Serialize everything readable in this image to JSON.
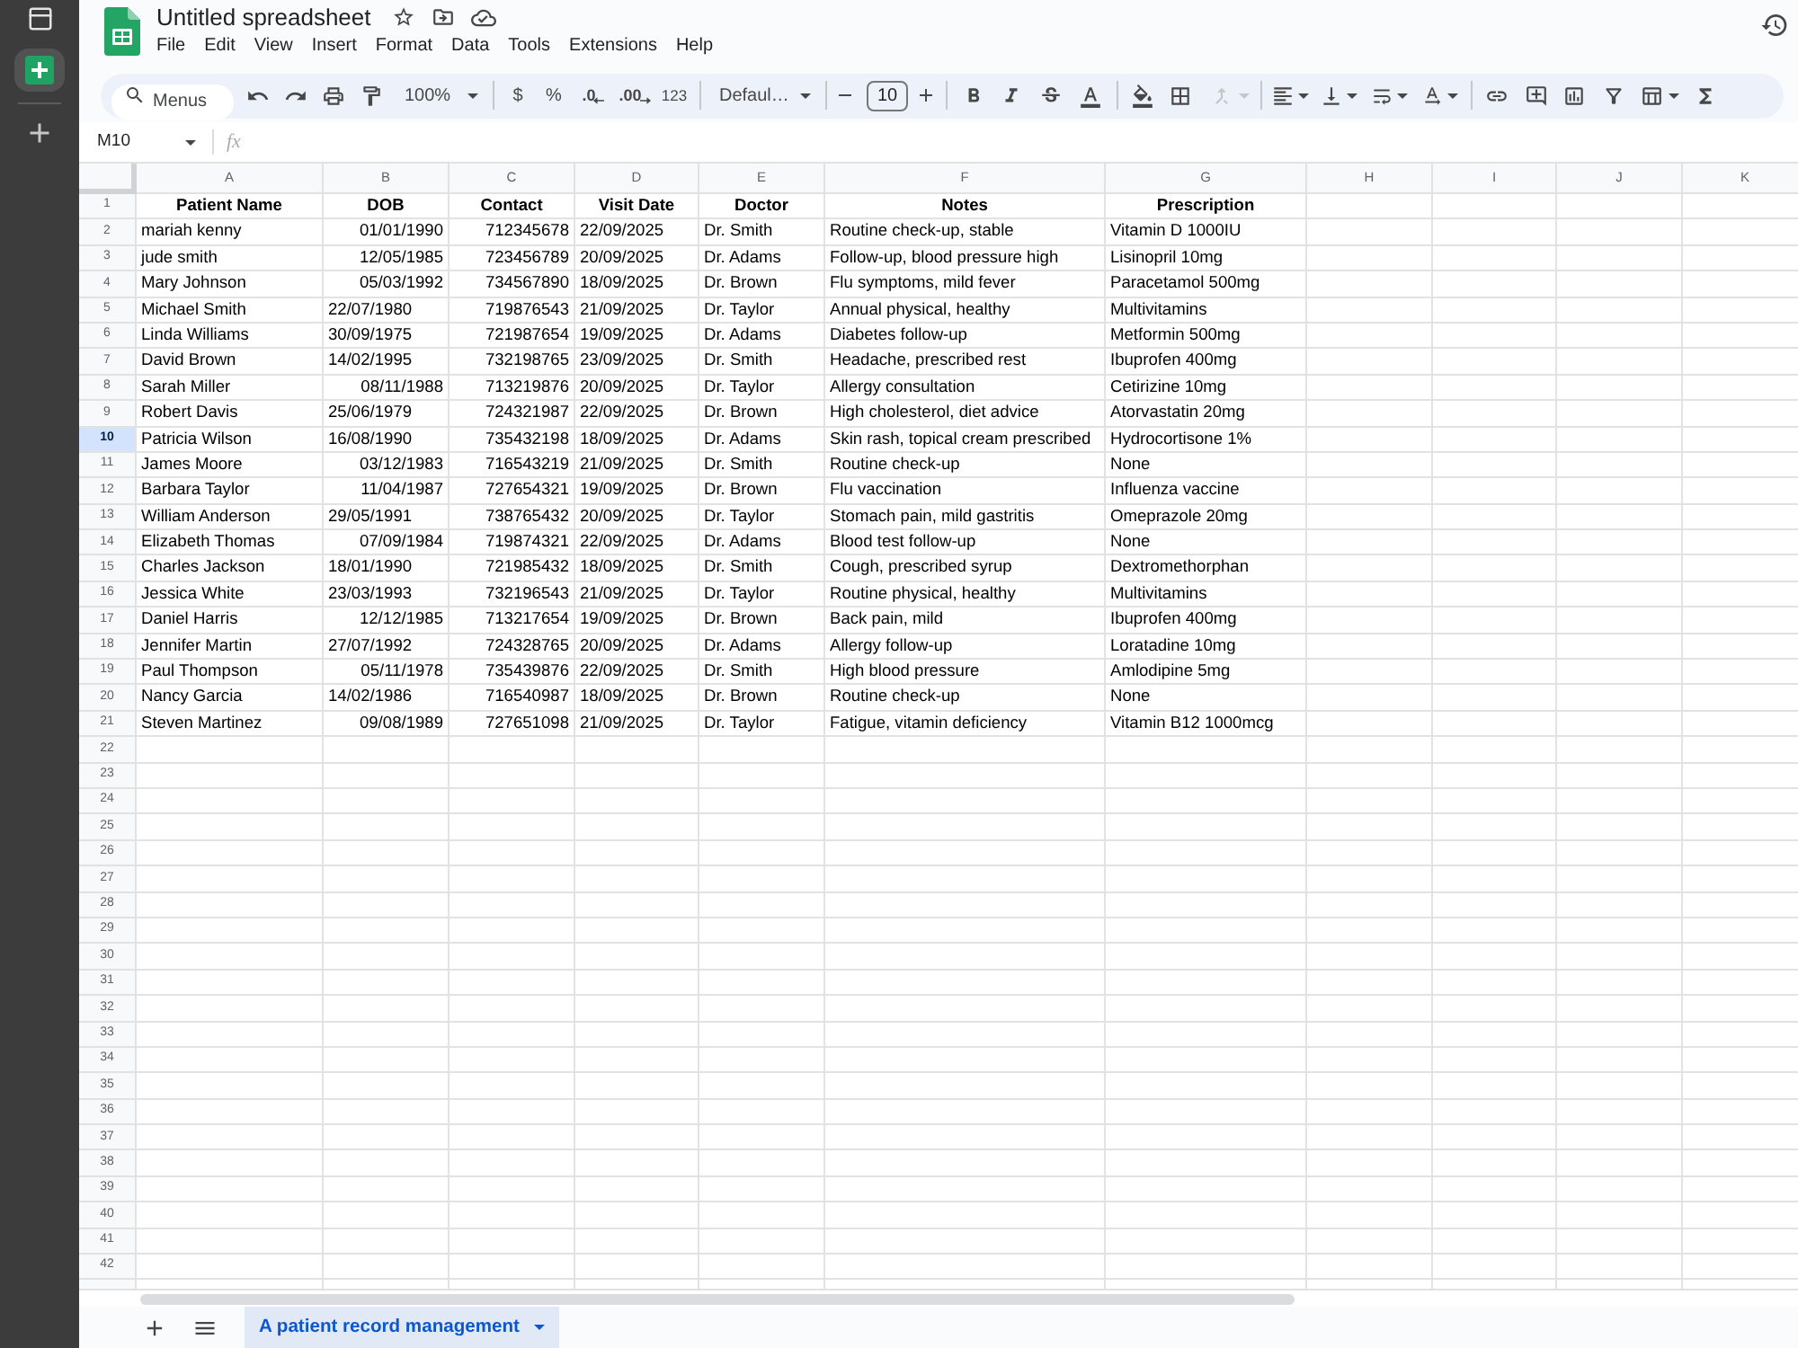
{
  "rail": {
    "items": [
      {
        "kind": "panel",
        "selected": false
      },
      {
        "kind": "sheets",
        "selected": true
      },
      {
        "kind": "add",
        "selected": false
      }
    ]
  },
  "app": {
    "title": "Untitled spreadsheet",
    "menu": [
      "File",
      "Edit",
      "View",
      "Insert",
      "Format",
      "Data",
      "Tools",
      "Extensions",
      "Help"
    ]
  },
  "toolbar": {
    "search": {
      "placeholder": "Menus"
    },
    "zoom": "100%",
    "currency": "$",
    "percent": "%",
    "decrease_decimal": ".0",
    "increase_decimal": ".00",
    "number_formats": "123",
    "font": "Defaul…",
    "font_size": {
      "value": "10"
    },
    "merge": {
      "disabled": true
    }
  },
  "formula_bar": {
    "cell": "M10",
    "function_label": "fx"
  },
  "grid": {
    "columns": [
      "A",
      "B",
      "C",
      "D",
      "E",
      "F",
      "G",
      "H",
      "I",
      "J",
      "K"
    ],
    "rows": [
      {
        "number": "1",
        "selected": false,
        "cells": [
          {
            "text": "Patient Name",
            "kind": "heading"
          },
          {
            "text": "DOB",
            "kind": "heading"
          },
          {
            "text": "Contact",
            "kind": "heading"
          },
          {
            "text": "Visit Date",
            "kind": "heading"
          },
          {
            "text": "Doctor",
            "kind": "heading"
          },
          {
            "text": "Notes",
            "kind": "heading"
          },
          {
            "text": "Prescription",
            "kind": "heading"
          }
        ]
      },
      {
        "number": "2",
        "selected": false,
        "cells": [
          {
            "text": "mariah kenny",
            "kind": "text"
          },
          {
            "text": "01/01/1990",
            "kind": "number"
          },
          {
            "text": "712345678",
            "kind": "number"
          },
          {
            "text": "22/09/2025",
            "kind": "text"
          },
          {
            "text": "Dr. Smith",
            "kind": "text"
          },
          {
            "text": "Routine check-up, stable",
            "kind": "text"
          },
          {
            "text": "Vitamin D 1000IU",
            "kind": "text"
          }
        ]
      },
      {
        "number": "3",
        "selected": false,
        "cells": [
          {
            "text": "jude smith",
            "kind": "text"
          },
          {
            "text": "12/05/1985",
            "kind": "number"
          },
          {
            "text": "723456789",
            "kind": "number"
          },
          {
            "text": "20/09/2025",
            "kind": "text"
          },
          {
            "text": "Dr. Adams",
            "kind": "text"
          },
          {
            "text": "Follow-up, blood pressure high",
            "kind": "text"
          },
          {
            "text": "Lisinopril 10mg",
            "kind": "text"
          }
        ]
      },
      {
        "number": "4",
        "selected": false,
        "cells": [
          {
            "text": "Mary Johnson",
            "kind": "text"
          },
          {
            "text": "05/03/1992",
            "kind": "number"
          },
          {
            "text": "734567890",
            "kind": "number"
          },
          {
            "text": "18/09/2025",
            "kind": "text"
          },
          {
            "text": "Dr. Brown",
            "kind": "text"
          },
          {
            "text": "Flu symptoms, mild fever",
            "kind": "text"
          },
          {
            "text": "Paracetamol 500mg",
            "kind": "text"
          }
        ]
      },
      {
        "number": "5",
        "selected": false,
        "cells": [
          {
            "text": "Michael Smith",
            "kind": "text"
          },
          {
            "text": "22/07/1980",
            "kind": "text"
          },
          {
            "text": "719876543",
            "kind": "number"
          },
          {
            "text": "21/09/2025",
            "kind": "text"
          },
          {
            "text": "Dr. Taylor",
            "kind": "text"
          },
          {
            "text": "Annual physical, healthy",
            "kind": "text"
          },
          {
            "text": "Multivitamins",
            "kind": "text"
          }
        ]
      },
      {
        "number": "6",
        "selected": false,
        "cells": [
          {
            "text": "Linda Williams",
            "kind": "text"
          },
          {
            "text": "30/09/1975",
            "kind": "text"
          },
          {
            "text": "721987654",
            "kind": "number"
          },
          {
            "text": "19/09/2025",
            "kind": "text"
          },
          {
            "text": "Dr. Adams",
            "kind": "text"
          },
          {
            "text": "Diabetes follow-up",
            "kind": "text"
          },
          {
            "text": "Metformin 500mg",
            "kind": "text"
          }
        ]
      },
      {
        "number": "7",
        "selected": false,
        "cells": [
          {
            "text": "David Brown",
            "kind": "text"
          },
          {
            "text": "14/02/1995",
            "kind": "text"
          },
          {
            "text": "732198765",
            "kind": "number"
          },
          {
            "text": "23/09/2025",
            "kind": "text"
          },
          {
            "text": "Dr. Smith",
            "kind": "text"
          },
          {
            "text": "Headache, prescribed rest",
            "kind": "text"
          },
          {
            "text": "Ibuprofen 400mg",
            "kind": "text"
          }
        ]
      },
      {
        "number": "8",
        "selected": false,
        "cells": [
          {
            "text": "Sarah Miller",
            "kind": "text"
          },
          {
            "text": "08/11/1988",
            "kind": "number"
          },
          {
            "text": "713219876",
            "kind": "number"
          },
          {
            "text": "20/09/2025",
            "kind": "text"
          },
          {
            "text": "Dr. Taylor",
            "kind": "text"
          },
          {
            "text": "Allergy consultation",
            "kind": "text"
          },
          {
            "text": "Cetirizine 10mg",
            "kind": "text"
          }
        ]
      },
      {
        "number": "9",
        "selected": false,
        "cells": [
          {
            "text": "Robert Davis",
            "kind": "text"
          },
          {
            "text": "25/06/1979",
            "kind": "text"
          },
          {
            "text": "724321987",
            "kind": "number"
          },
          {
            "text": "22/09/2025",
            "kind": "text"
          },
          {
            "text": "Dr. Brown",
            "kind": "text"
          },
          {
            "text": "High cholesterol, diet advice",
            "kind": "text"
          },
          {
            "text": "Atorvastatin 20mg",
            "kind": "text"
          }
        ]
      },
      {
        "number": "10",
        "selected": true,
        "cells": [
          {
            "text": "Patricia Wilson",
            "kind": "text"
          },
          {
            "text": "16/08/1990",
            "kind": "text"
          },
          {
            "text": "735432198",
            "kind": "number"
          },
          {
            "text": "18/09/2025",
            "kind": "text"
          },
          {
            "text": "Dr. Adams",
            "kind": "text"
          },
          {
            "text": "Skin rash, topical cream prescribed",
            "kind": "text"
          },
          {
            "text": "Hydrocortisone 1%",
            "kind": "text"
          }
        ]
      },
      {
        "number": "11",
        "selected": false,
        "cells": [
          {
            "text": "James Moore",
            "kind": "text"
          },
          {
            "text": "03/12/1983",
            "kind": "number"
          },
          {
            "text": "716543219",
            "kind": "number"
          },
          {
            "text": "21/09/2025",
            "kind": "text"
          },
          {
            "text": "Dr. Smith",
            "kind": "text"
          },
          {
            "text": "Routine check-up",
            "kind": "text"
          },
          {
            "text": "None",
            "kind": "text"
          }
        ]
      },
      {
        "number": "12",
        "selected": false,
        "cells": [
          {
            "text": "Barbara Taylor",
            "kind": "text"
          },
          {
            "text": "11/04/1987",
            "kind": "number"
          },
          {
            "text": "727654321",
            "kind": "number"
          },
          {
            "text": "19/09/2025",
            "kind": "text"
          },
          {
            "text": "Dr. Brown",
            "kind": "text"
          },
          {
            "text": "Flu vaccination",
            "kind": "text"
          },
          {
            "text": "Influenza vaccine",
            "kind": "text"
          }
        ]
      },
      {
        "number": "13",
        "selected": false,
        "cells": [
          {
            "text": "William Anderson",
            "kind": "text"
          },
          {
            "text": "29/05/1991",
            "kind": "text"
          },
          {
            "text": "738765432",
            "kind": "number"
          },
          {
            "text": "20/09/2025",
            "kind": "text"
          },
          {
            "text": "Dr. Taylor",
            "kind": "text"
          },
          {
            "text": "Stomach pain, mild gastritis",
            "kind": "text"
          },
          {
            "text": "Omeprazole 20mg",
            "kind": "text"
          }
        ]
      },
      {
        "number": "14",
        "selected": false,
        "cells": [
          {
            "text": "Elizabeth Thomas",
            "kind": "text"
          },
          {
            "text": "07/09/1984",
            "kind": "number"
          },
          {
            "text": "719874321",
            "kind": "number"
          },
          {
            "text": "22/09/2025",
            "kind": "text"
          },
          {
            "text": "Dr. Adams",
            "kind": "text"
          },
          {
            "text": "Blood test follow-up",
            "kind": "text"
          },
          {
            "text": "None",
            "kind": "text"
          }
        ]
      },
      {
        "number": "15",
        "selected": false,
        "cells": [
          {
            "text": "Charles Jackson",
            "kind": "text"
          },
          {
            "text": "18/01/1990",
            "kind": "text"
          },
          {
            "text": "721985432",
            "kind": "number"
          },
          {
            "text": "18/09/2025",
            "kind": "text"
          },
          {
            "text": "Dr. Smith",
            "kind": "text"
          },
          {
            "text": "Cough, prescribed syrup",
            "kind": "text"
          },
          {
            "text": "Dextromethorphan",
            "kind": "text"
          }
        ]
      },
      {
        "number": "16",
        "selected": false,
        "cells": [
          {
            "text": "Jessica White",
            "kind": "text"
          },
          {
            "text": "23/03/1993",
            "kind": "text"
          },
          {
            "text": "732196543",
            "kind": "number"
          },
          {
            "text": "21/09/2025",
            "kind": "text"
          },
          {
            "text": "Dr. Taylor",
            "kind": "text"
          },
          {
            "text": "Routine physical, healthy",
            "kind": "text"
          },
          {
            "text": "Multivitamins",
            "kind": "text"
          }
        ]
      },
      {
        "number": "17",
        "selected": false,
        "cells": [
          {
            "text": "Daniel Harris",
            "kind": "text"
          },
          {
            "text": "12/12/1985",
            "kind": "number"
          },
          {
            "text": "713217654",
            "kind": "number"
          },
          {
            "text": "19/09/2025",
            "kind": "text"
          },
          {
            "text": "Dr. Brown",
            "kind": "text"
          },
          {
            "text": "Back pain, mild",
            "kind": "text"
          },
          {
            "text": "Ibuprofen 400mg",
            "kind": "text"
          }
        ]
      },
      {
        "number": "18",
        "selected": false,
        "cells": [
          {
            "text": "Jennifer Martin",
            "kind": "text"
          },
          {
            "text": "27/07/1992",
            "kind": "text"
          },
          {
            "text": "724328765",
            "kind": "number"
          },
          {
            "text": "20/09/2025",
            "kind": "text"
          },
          {
            "text": "Dr. Adams",
            "kind": "text"
          },
          {
            "text": "Allergy follow-up",
            "kind": "text"
          },
          {
            "text": "Loratadine 10mg",
            "kind": "text"
          }
        ]
      },
      {
        "number": "19",
        "selected": false,
        "cells": [
          {
            "text": "Paul Thompson",
            "kind": "text"
          },
          {
            "text": "05/11/1978",
            "kind": "number"
          },
          {
            "text": "735439876",
            "kind": "number"
          },
          {
            "text": "22/09/2025",
            "kind": "text"
          },
          {
            "text": "Dr. Smith",
            "kind": "text"
          },
          {
            "text": "High blood pressure",
            "kind": "text"
          },
          {
            "text": "Amlodipine 5mg",
            "kind": "text"
          }
        ]
      },
      {
        "number": "20",
        "selected": false,
        "cells": [
          {
            "text": "Nancy Garcia",
            "kind": "text"
          },
          {
            "text": "14/02/1986",
            "kind": "text"
          },
          {
            "text": "716540987",
            "kind": "number"
          },
          {
            "text": "18/09/2025",
            "kind": "text"
          },
          {
            "text": "Dr. Brown",
            "kind": "text"
          },
          {
            "text": "Routine check-up",
            "kind": "text"
          },
          {
            "text": "None",
            "kind": "text"
          }
        ]
      },
      {
        "number": "21",
        "selected": false,
        "cells": [
          {
            "text": "Steven Martinez",
            "kind": "text"
          },
          {
            "text": "09/08/1989",
            "kind": "number"
          },
          {
            "text": "727651098",
            "kind": "number"
          },
          {
            "text": "21/09/2025",
            "kind": "text"
          },
          {
            "text": "Dr. Taylor",
            "kind": "text"
          },
          {
            "text": "Fatigue, vitamin deficiency",
            "kind": "text"
          },
          {
            "text": "Vitamin B12 1000mcg",
            "kind": "text"
          }
        ]
      },
      {
        "number": "22",
        "selected": false
      },
      {
        "number": "23",
        "selected": false
      },
      {
        "number": "24",
        "selected": false
      },
      {
        "number": "25",
        "selected": false
      },
      {
        "number": "26",
        "selected": false
      },
      {
        "number": "27",
        "selected": false
      },
      {
        "number": "28",
        "selected": false
      },
      {
        "number": "29",
        "selected": false
      },
      {
        "number": "30",
        "selected": false
      },
      {
        "number": "31",
        "selected": false
      },
      {
        "number": "32",
        "selected": false
      },
      {
        "number": "33",
        "selected": false
      },
      {
        "number": "34",
        "selected": false
      },
      {
        "number": "35",
        "selected": false
      },
      {
        "number": "36",
        "selected": false
      },
      {
        "number": "37",
        "selected": false
      },
      {
        "number": "38",
        "selected": false
      },
      {
        "number": "39",
        "selected": false
      },
      {
        "number": "40",
        "selected": false
      },
      {
        "number": "41",
        "selected": false
      },
      {
        "number": "42",
        "selected": false
      }
    ]
  },
  "sheet_bar": {
    "tabs": [
      {
        "label": "A patient record management",
        "selected": true
      }
    ]
  }
}
